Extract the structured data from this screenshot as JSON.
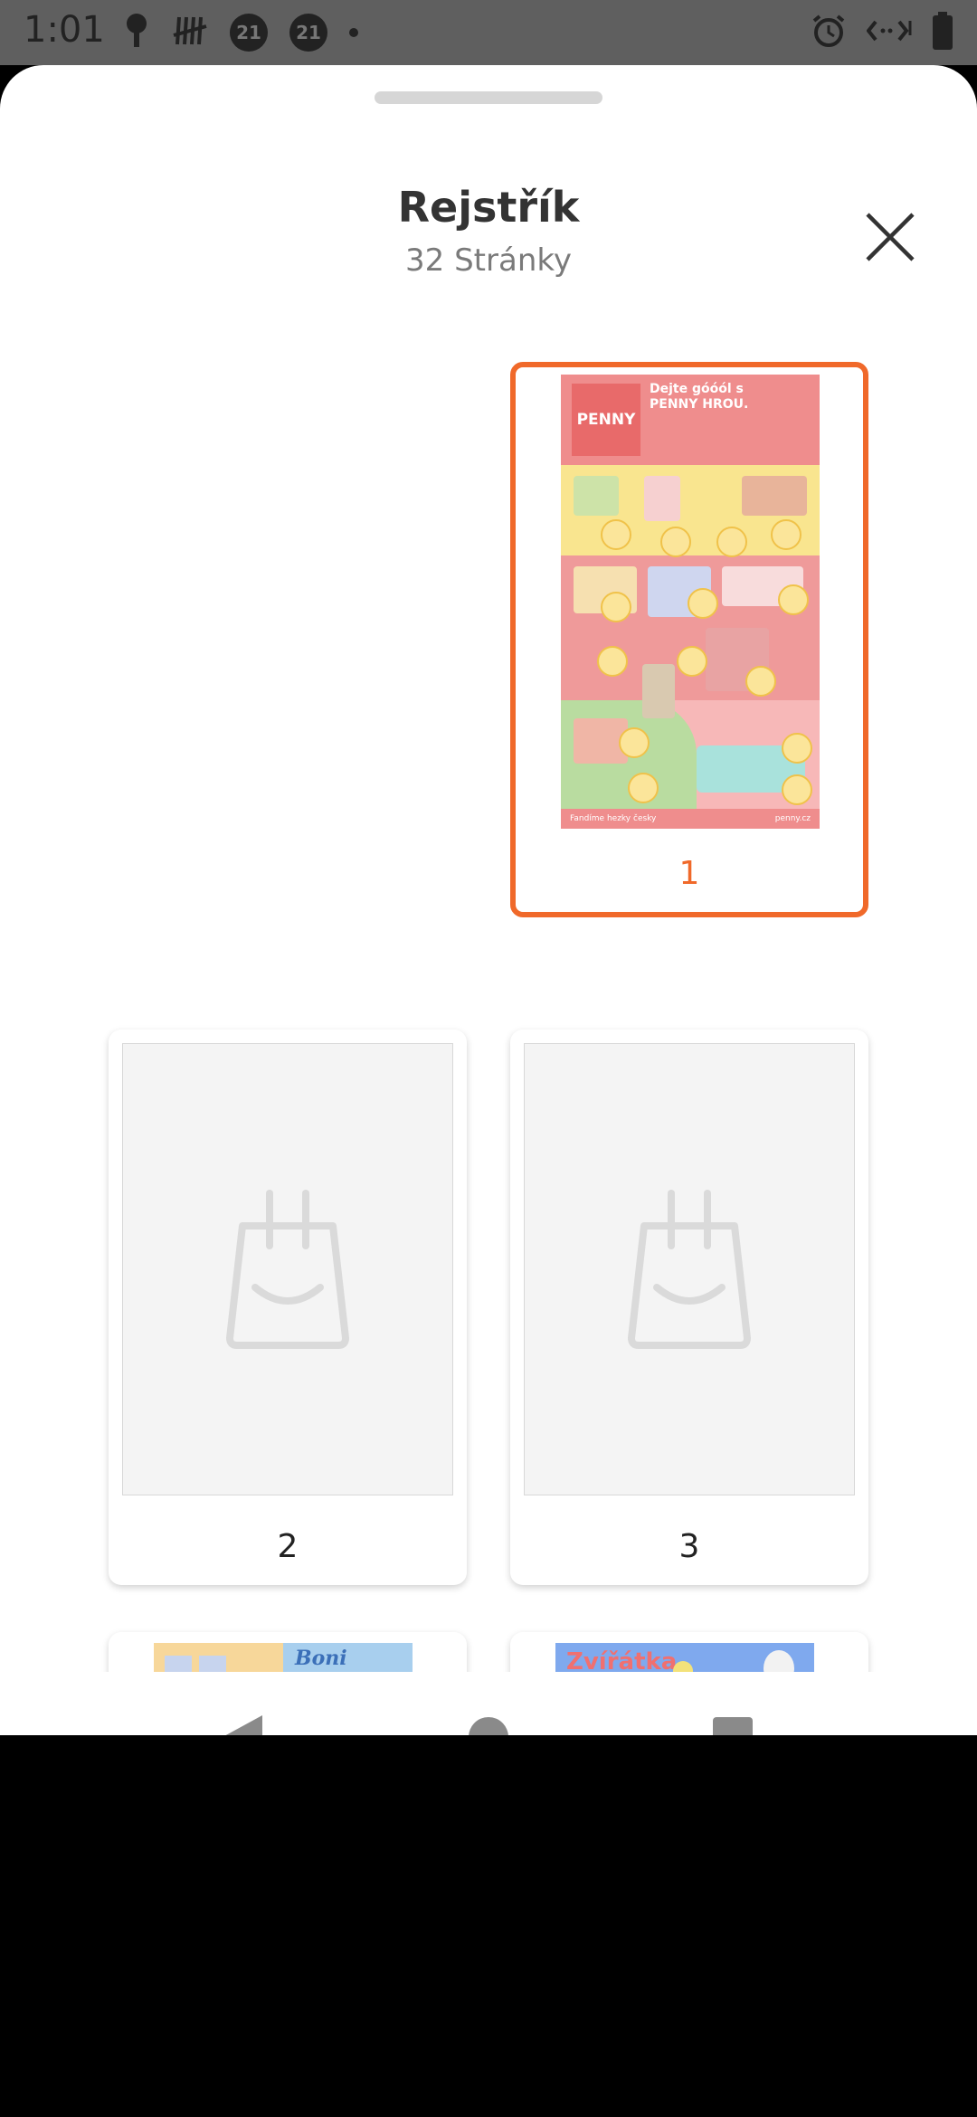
{
  "status_bar": {
    "time": "1:01",
    "badges": [
      "21",
      "21"
    ]
  },
  "sheet": {
    "title": "Rejstřík",
    "subtitle": "32 Stránky"
  },
  "pages": [
    {
      "number": "1",
      "selected": true
    },
    {
      "number": "2",
      "selected": false
    },
    {
      "number": "3",
      "selected": false
    }
  ],
  "flyer": {
    "logo": "PENNY",
    "headline": "Dejte góóól s PENNY HROU.",
    "footer_left": "Fandíme hezky česky",
    "footer_right": "penny.cz"
  },
  "partial_pages": {
    "page4_label": "Boni",
    "page5_label": "Zvířátka"
  },
  "colors": {
    "accent": "#f0692a",
    "sheet_bg": "#ffffff",
    "placeholder_bg": "#f4f4f4"
  }
}
